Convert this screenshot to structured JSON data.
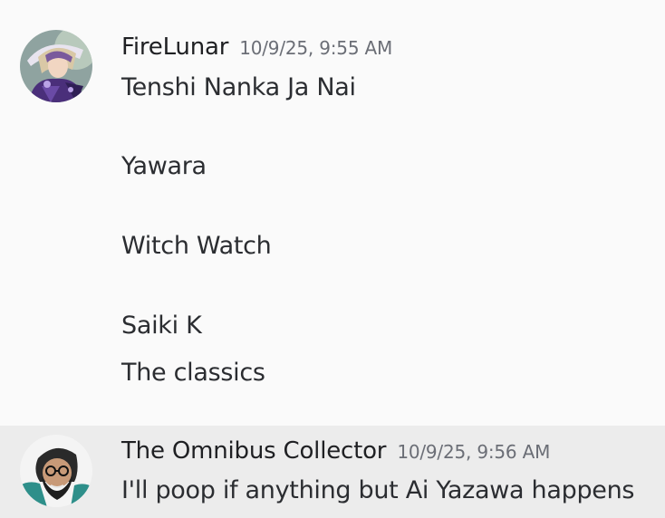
{
  "messages": [
    {
      "username": "FireLunar",
      "timestamp": "10/9/25, 9:55 AM",
      "avatar_icon": "user-avatar-anime-character",
      "lines": [
        "Tenshi Nanka Ja Nai",
        "Yawara",
        "Witch Watch",
        "Saiki K",
        "The classics"
      ]
    },
    {
      "username": "The Omnibus Collector",
      "timestamp": "10/9/25, 9:56 AM",
      "avatar_icon": "user-avatar-bearded-man",
      "lines": [
        "I'll poop if anything but Ai Yazawa happens"
      ]
    }
  ],
  "colors": {
    "background": "#fafafa",
    "hover_background": "#ececec",
    "username": "#1f2023",
    "timestamp": "#6b6e76",
    "message_text": "#2b2d31"
  }
}
